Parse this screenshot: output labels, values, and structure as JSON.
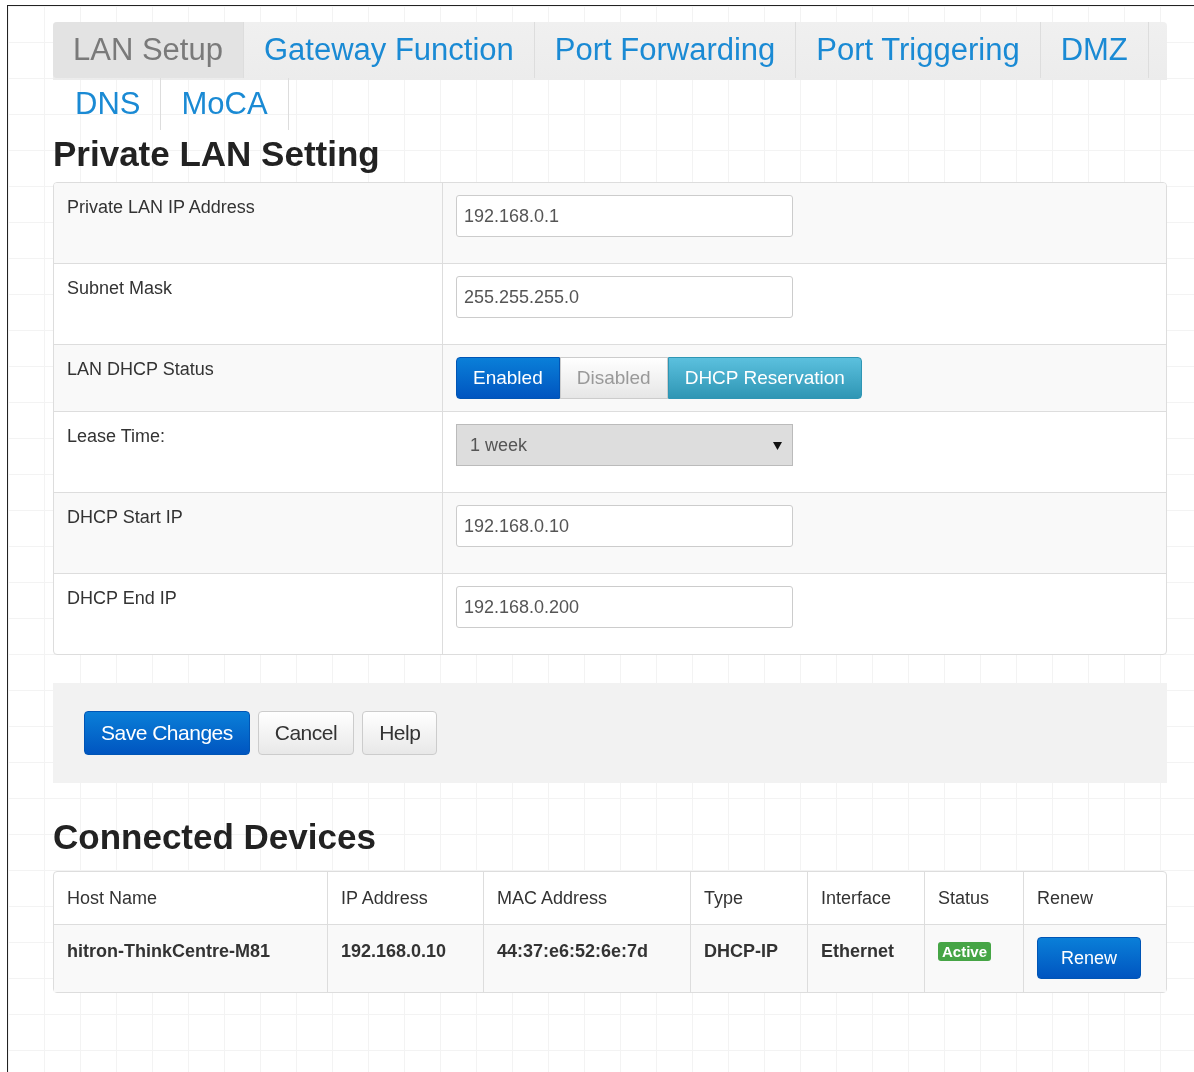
{
  "tabs": [
    {
      "label": "LAN Setup",
      "selected": true
    },
    {
      "label": "Gateway Function",
      "selected": false
    },
    {
      "label": "Port Forwarding",
      "selected": false
    },
    {
      "label": "Port Triggering",
      "selected": false
    },
    {
      "label": "DMZ",
      "selected": false
    },
    {
      "label": "DNS",
      "selected": false
    },
    {
      "label": "MoCA",
      "selected": false
    }
  ],
  "private_lan": {
    "title": "Private LAN Setting",
    "rows": [
      {
        "kind": "input",
        "label": "Private LAN IP Address",
        "value": "192.168.0.1"
      },
      {
        "kind": "input",
        "label": "Subnet Mask",
        "value": "255.255.255.0"
      },
      {
        "kind": "toggle",
        "label": "LAN DHCP Status",
        "options": [
          {
            "label": "Enabled",
            "selected": true
          },
          {
            "label": "Disabled",
            "selected": false
          }
        ],
        "extra_button": "DHCP Reservation"
      },
      {
        "kind": "select",
        "label": "Lease Time:",
        "value": "1 week"
      },
      {
        "kind": "input",
        "label": "DHCP Start IP",
        "value": "192.168.0.10"
      },
      {
        "kind": "input",
        "label": "DHCP End IP",
        "value": "192.168.0.200"
      }
    ]
  },
  "actions": [
    {
      "label": "Save Changes",
      "kind": "primary"
    },
    {
      "label": "Cancel",
      "kind": "default"
    },
    {
      "label": "Help",
      "kind": "default"
    }
  ],
  "connected_devices": {
    "title": "Connected Devices",
    "columns": [
      "Host Name",
      "IP Address",
      "MAC Address",
      "Type",
      "Interface",
      "Status",
      "Renew"
    ],
    "rows": [
      {
        "host": "hitron-ThinkCentre-M81",
        "ip": "192.168.0.10",
        "mac": "44:37:e6:52:6e:7d",
        "type": "DHCP-IP",
        "interface": "Ethernet",
        "status": "Active",
        "renew": "Renew"
      }
    ]
  }
}
